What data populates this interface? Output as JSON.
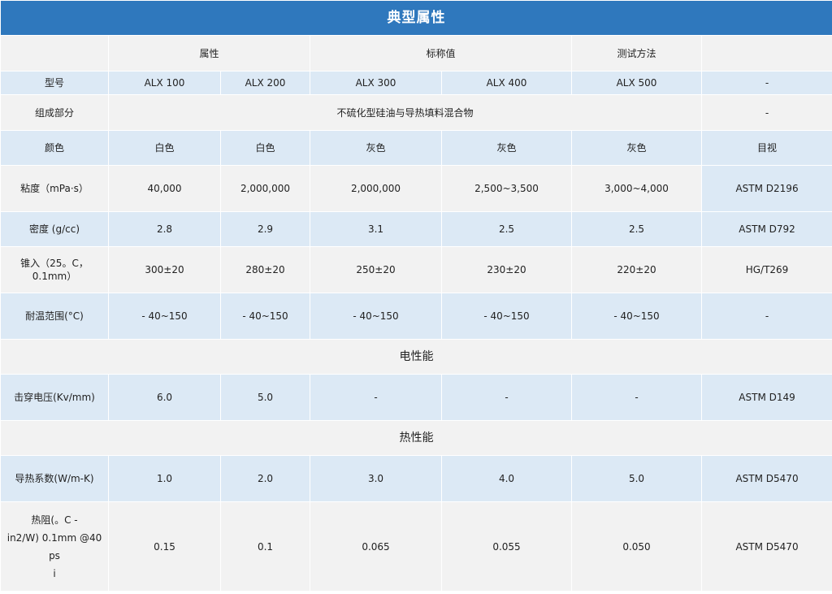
{
  "title": "典型属性",
  "header": {
    "property": "属性",
    "nominal": "标称值",
    "method": "测试方法"
  },
  "rows": [
    {
      "label": "型号",
      "values": [
        "ALX 100",
        "ALX 200",
        "ALX 300",
        "ALX 400",
        "ALX 500"
      ],
      "method": "-"
    },
    {
      "label": "组成部分",
      "merged": "不硫化型硅油与导热填料混合物",
      "method": "-"
    },
    {
      "label": "颜色",
      "values": [
        "白色",
        "白色",
        "灰色",
        "灰色",
        "灰色"
      ],
      "method": "目视"
    },
    {
      "label": "粘度（mPa·s）",
      "values": [
        "40,000",
        "2,000,000",
        "2,000,000",
        "2,500~3,500",
        "3,000~4,000"
      ],
      "method": "ASTM D2196"
    },
    {
      "label": "密度 (g/cc)",
      "values": [
        "2.8",
        "2.9",
        "3.1",
        "2.5",
        "2.5"
      ],
      "method": "ASTM D792"
    },
    {
      "label": "锥入（25。C，0.1mm）",
      "values": [
        "300±20",
        "280±20",
        "250±20",
        "230±20",
        "220±20"
      ],
      "method": "HG/T269"
    },
    {
      "label": "耐温范围(°C)",
      "values": [
        "- 40~150",
        "- 40~150",
        "- 40~150",
        "- 40~150",
        "- 40~150"
      ],
      "method": "-"
    }
  ],
  "section_electrical": "电性能",
  "electrical_rows": [
    {
      "label": "击穿电压(Kv/mm)",
      "values": [
        "6.0",
        "5.0",
        "-",
        "-",
        "-"
      ],
      "method": "ASTM D149"
    }
  ],
  "section_thermal": "热性能",
  "thermal_rows": [
    {
      "label": "导热系数(W/m-K)",
      "values": [
        "1.0",
        "2.0",
        "3.0",
        "4.0",
        "5.0"
      ],
      "method": "ASTM D5470"
    },
    {
      "label_lines": [
        "热阻(。C -",
        "in2/W) 0.1mm @40 ps",
        "i"
      ],
      "values": [
        "0.15",
        "0.1",
        "0.065",
        "0.055",
        "0.050"
      ],
      "method": "ASTM D5470"
    }
  ]
}
